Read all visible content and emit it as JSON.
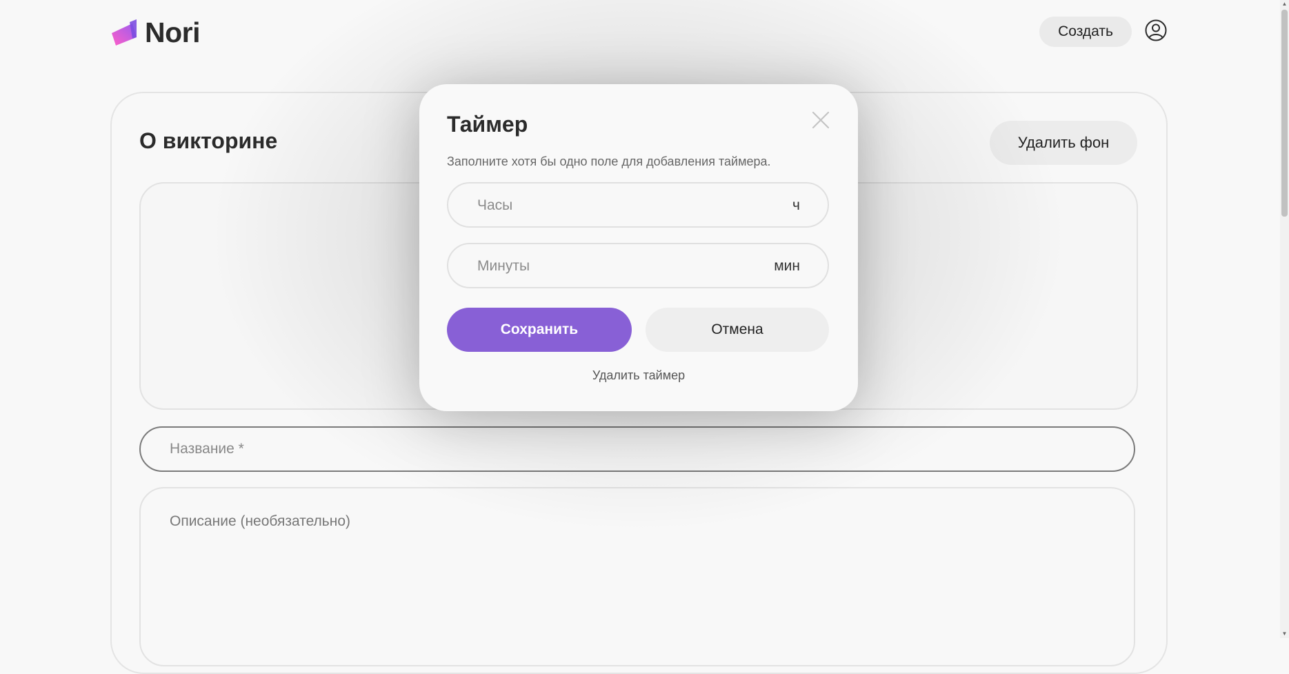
{
  "header": {
    "logo_text": "Nori",
    "create_label": "Создать",
    "icons": {
      "user": "user-circle-icon",
      "logo": "logo-mark-icon"
    }
  },
  "quiz": {
    "title": "О викторине",
    "remove_background_label": "Удалить фон",
    "name_placeholder": "Название *",
    "description_placeholder": "Описание (необязательно)"
  },
  "modal": {
    "title": "Таймер",
    "hint": "Заполните хотя бы одно поле для добавления таймера.",
    "hours_placeholder": "Часы",
    "hours_unit": "ч",
    "minutes_placeholder": "Минуты",
    "minutes_unit": "мин",
    "save_label": "Сохранить",
    "cancel_label": "Отмена",
    "delete_label": "Удалить таймер",
    "close_icon": "close-icon"
  },
  "colors": {
    "accent": "#8860d6",
    "background": "#f8f8f8",
    "text": "#2b2b2b",
    "logo_gradient": [
      "#ff5fc8",
      "#9a5cf0"
    ]
  }
}
